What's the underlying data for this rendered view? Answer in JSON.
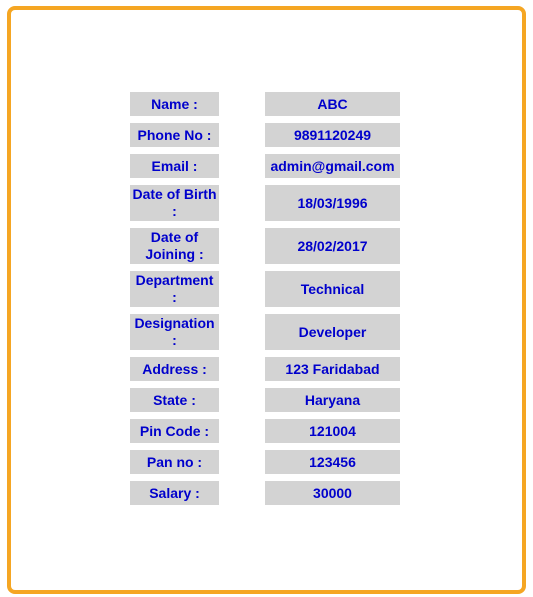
{
  "rows": [
    {
      "label": "Name :",
      "value": "ABC"
    },
    {
      "label": "Phone No :",
      "value": "9891120249"
    },
    {
      "label": "Email :",
      "value": "admin@gmail.com"
    },
    {
      "label": "Date of Birth :",
      "value": "18/03/1996"
    },
    {
      "label": "Date of Joining :",
      "value": "28/02/2017"
    },
    {
      "label": "Department :",
      "value": "Technical"
    },
    {
      "label": "Designation :",
      "value": "Developer"
    },
    {
      "label": "Address :",
      "value": "123 Faridabad"
    },
    {
      "label": "State :",
      "value": "Haryana"
    },
    {
      "label": "Pin Code :",
      "value": "121004"
    },
    {
      "label": "Pan no :",
      "value": "123456"
    },
    {
      "label": "Salary :",
      "value": "30000"
    }
  ],
  "colors": {
    "border": "#f5a623",
    "cell_bg": "#d3d3d3",
    "text": "#0000cc"
  }
}
